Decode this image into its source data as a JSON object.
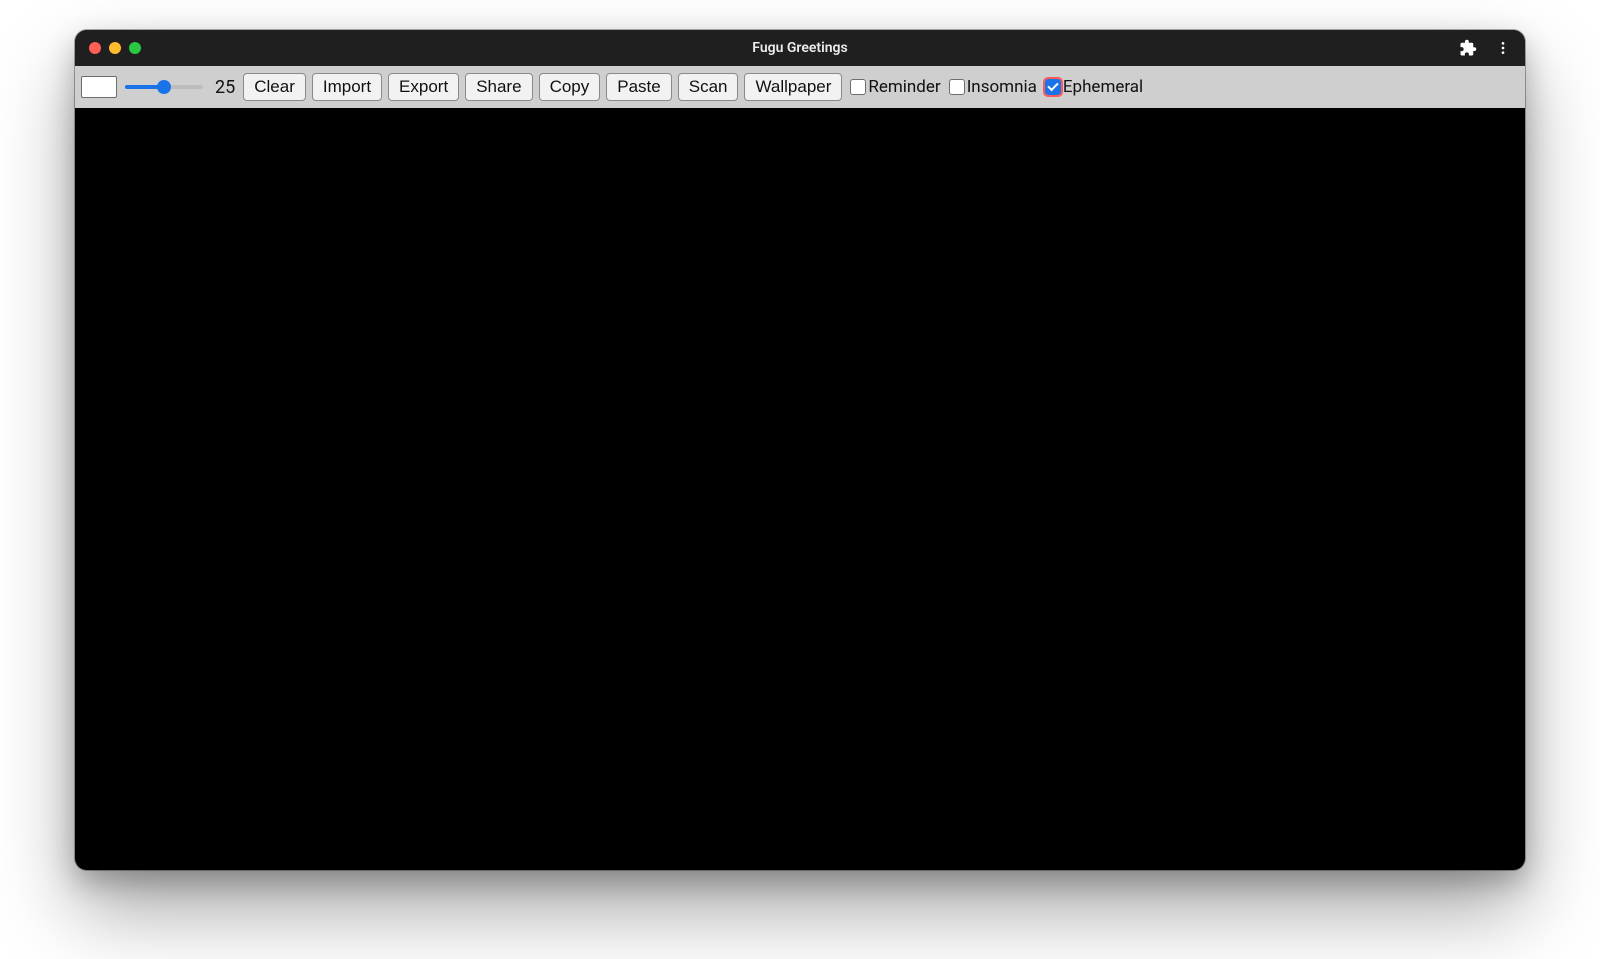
{
  "window": {
    "title": "Fugu Greetings"
  },
  "toolbar": {
    "slider_value": "25",
    "buttons": {
      "clear": "Clear",
      "import": "Import",
      "export": "Export",
      "share": "Share",
      "copy": "Copy",
      "paste": "Paste",
      "scan": "Scan",
      "wallpaper": "Wallpaper"
    },
    "checkboxes": {
      "reminder": {
        "label": "Reminder",
        "checked": false
      },
      "insomnia": {
        "label": "Insomnia",
        "checked": false
      },
      "ephemeral": {
        "label": "Ephemeral",
        "checked": true
      }
    }
  },
  "slider": {
    "min": 0,
    "max": 50,
    "value": 25
  },
  "colors": {
    "accent": "#1a73e8",
    "titlebar": "#1f1f1f",
    "toolbar": "#cfcfcf",
    "canvas": "#000000"
  }
}
